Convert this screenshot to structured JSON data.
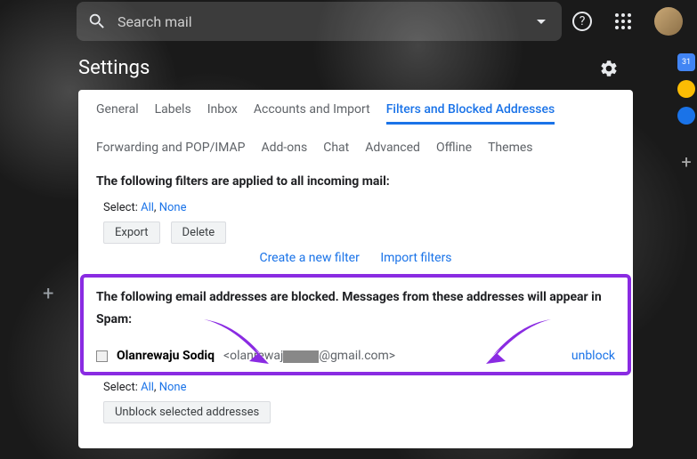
{
  "search": {
    "placeholder": "Search mail"
  },
  "settings_title": "Settings",
  "tabs": {
    "general": "General",
    "labels": "Labels",
    "inbox": "Inbox",
    "accounts": "Accounts and Import",
    "filters": "Filters and Blocked Addresses",
    "forwarding": "Forwarding and POP/IMAP",
    "addons": "Add-ons",
    "chat": "Chat",
    "advanced": "Advanced",
    "offline": "Offline",
    "themes": "Themes"
  },
  "filters": {
    "heading": "The following filters are applied to all incoming mail:",
    "select_label": "Select:",
    "select_all": "All",
    "select_none": "None",
    "export_btn": "Export",
    "delete_btn": "Delete",
    "create_link": "Create a new filter",
    "import_link": "Import filters"
  },
  "blocked": {
    "heading1": "The following email addresses are blocked. Messages from these addresses will appear in",
    "heading2": "Spam:",
    "sender_name": "Olanrewaju Sodiq",
    "sender_email_pre": "<olanrewaj",
    "sender_email_post": "@gmail.com>",
    "unblock": "unblock",
    "select_label": "Select:",
    "select_all": "All",
    "select_none": "None",
    "unblock_selected_btn": "Unblock selected addresses"
  },
  "calendar_day": "31"
}
